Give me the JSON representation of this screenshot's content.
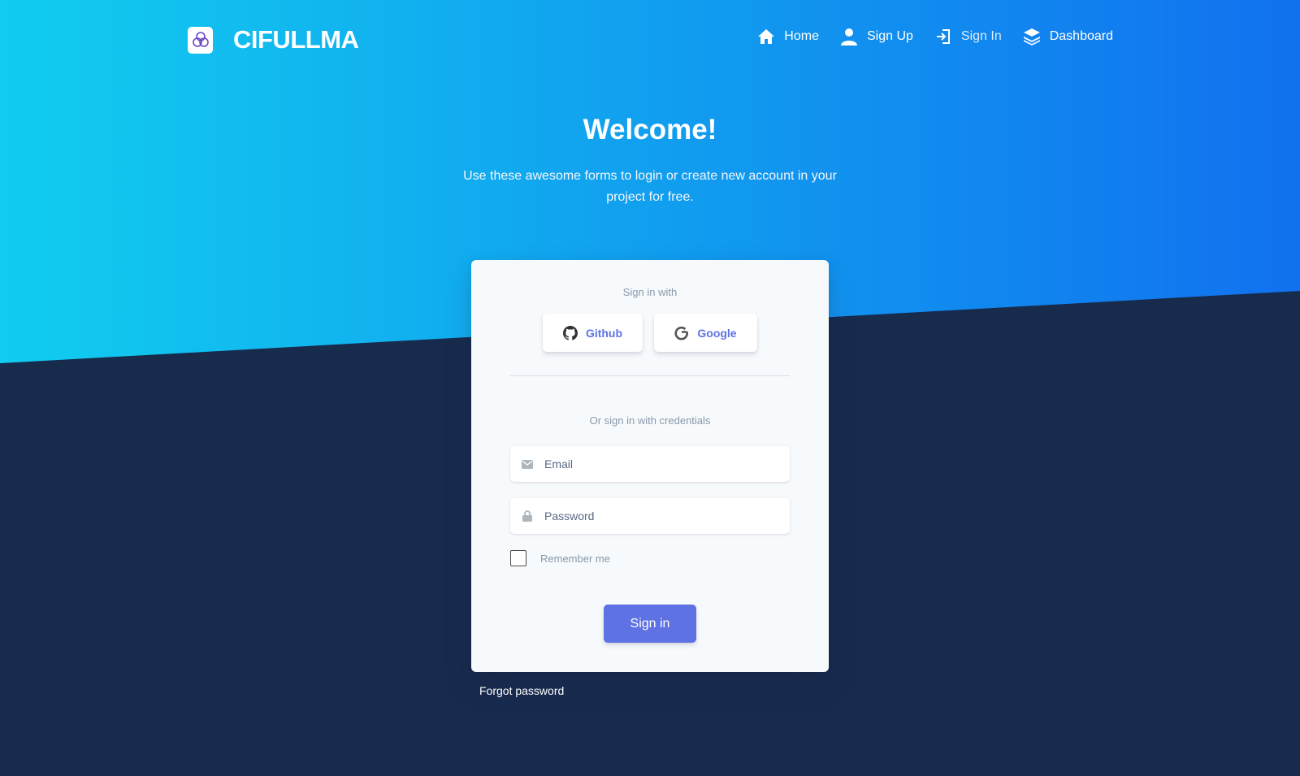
{
  "brand": {
    "name": "CIFULLMA",
    "logo_icon": "triquetra-icon"
  },
  "nav": {
    "items": [
      {
        "label": "Home",
        "icon": "home-icon"
      },
      {
        "label": "Sign Up",
        "icon": "user-icon"
      },
      {
        "label": "Sign In",
        "icon": "sign-in-icon"
      },
      {
        "label": "Dashboard",
        "icon": "layers-icon"
      }
    ]
  },
  "hero": {
    "title": "Welcome!",
    "subtitle": "Use these awesome forms to login or create new account in your project for free."
  },
  "card": {
    "sign_in_with": "Sign in with",
    "github_label": "Github",
    "google_label": "Google",
    "credentials_label": "Or sign in with credentials",
    "email_placeholder": "Email",
    "password_placeholder": "Password",
    "remember_label": "Remember me",
    "signin_label": "Sign in"
  },
  "forgot_label": "Forgot password",
  "colors": {
    "gradient_start": "#11cdef",
    "gradient_end": "#1171ef",
    "background": "#172b4d",
    "primary": "#5e72e4"
  }
}
